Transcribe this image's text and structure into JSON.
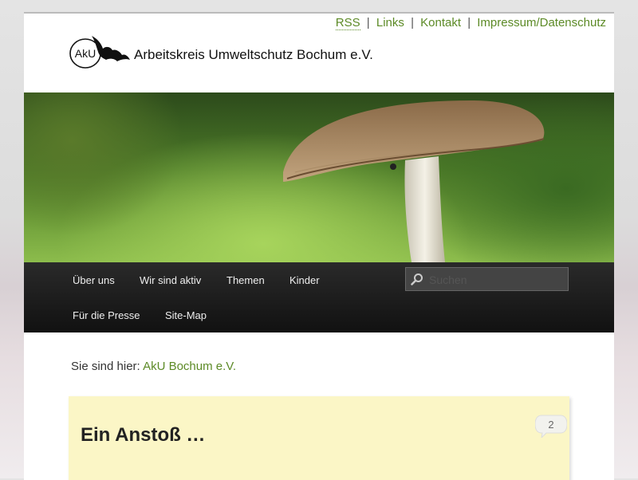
{
  "header": {
    "links": [
      {
        "label": "RSS"
      },
      {
        "label": "Links"
      },
      {
        "label": "Kontakt"
      },
      {
        "label": "Impressum/Datenschutz"
      }
    ],
    "separator": "|",
    "logo_abbr": "AkU",
    "site_name": "Arbeitskreis Umweltschutz Bochum e.V."
  },
  "nav": {
    "items": [
      {
        "label": "Über uns"
      },
      {
        "label": "Wir sind aktiv"
      },
      {
        "label": "Themen"
      },
      {
        "label": "Kinder"
      },
      {
        "label": "Für die Presse"
      },
      {
        "label": "Site-Map"
      }
    ],
    "search_placeholder": "Suchen"
  },
  "breadcrumb": {
    "prefix": "Sie sind hier:",
    "current": "AkU Bochum e.V."
  },
  "post": {
    "title": "Ein Anstoß …",
    "comment_count": "2"
  },
  "colors": {
    "link": "#5c8a26",
    "nav_background": "#1a1a1a",
    "post_background": "#fbf6c6"
  }
}
